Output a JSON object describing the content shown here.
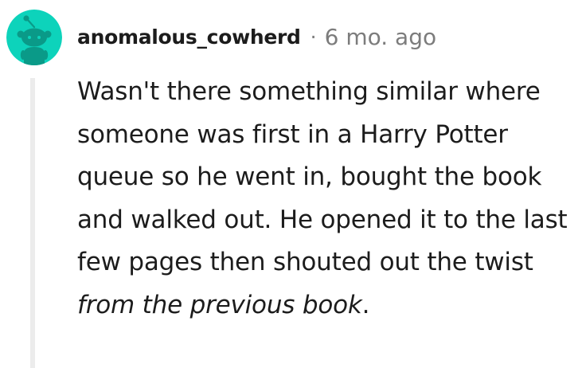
{
  "comment": {
    "author": "anomalous_cowherd",
    "separator": "·",
    "timestamp": "6 mo. ago",
    "avatar": {
      "icon": "snoo-avatar-icon",
      "background_color": "#0dd3bb"
    },
    "body": {
      "text_before_emphasis": "Wasn't there something similar where someone was first in a Harry Potter queue so he went in, bought the book and walked out. He opened it to the last few pages then shouted out the twist ",
      "emphasis": "from the previous book",
      "text_after_emphasis": "."
    }
  }
}
